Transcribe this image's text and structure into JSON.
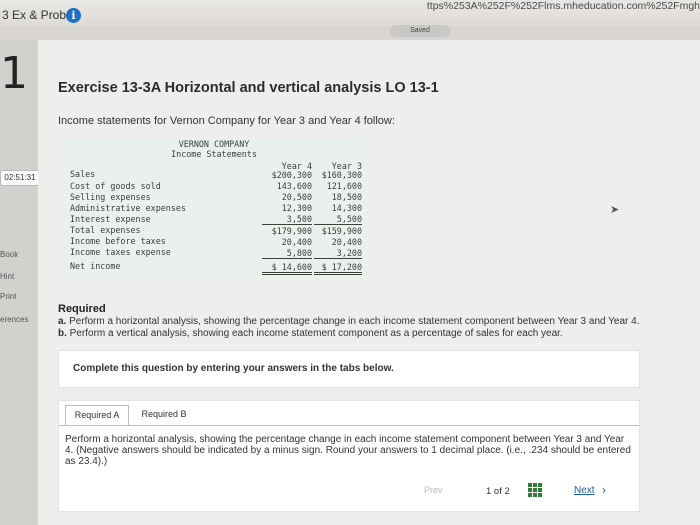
{
  "browser": {
    "tab_title": "3 Ex & Prob",
    "url": "ttps%253A%252F%252Flms.mheducation.com%252Fmgh",
    "saved_label": "Saved"
  },
  "sidebar": {
    "question_number": "1",
    "timer": "02:51:31",
    "items": [
      {
        "label": "Book"
      },
      {
        "label": "Hint"
      },
      {
        "label": "Print"
      },
      {
        "label": "erences"
      }
    ]
  },
  "exercise": {
    "title": "Exercise 13-3A Horizontal and vertical analysis LO 13-1",
    "intro": "Income statements for Vernon Company for Year 3 and Year 4 follow:"
  },
  "statement": {
    "company": "VERNON COMPANY",
    "heading": "Income Statements",
    "col_year4": "Year 4",
    "col_year3": "Year 3",
    "rows": [
      {
        "label": "Sales",
        "y4": "$200,300",
        "y3": "$160,300"
      },
      {
        "label": "Cost of goods sold",
        "y4": "143,600",
        "y3": "121,600"
      },
      {
        "label": "Selling expenses",
        "y4": "20,500",
        "y3": "18,500"
      },
      {
        "label": "Administrative expenses",
        "y4": "12,300",
        "y3": "14,300"
      },
      {
        "label": "Interest expense",
        "y4": "3,500",
        "y3": "5,500"
      },
      {
        "label": "Total expenses",
        "y4": "$179,900",
        "y3": "$159,900"
      },
      {
        "label": "Income before taxes",
        "y4": "20,400",
        "y3": "20,400"
      },
      {
        "label": "Income taxes expense",
        "y4": "5,800",
        "y3": "3,200"
      },
      {
        "label": "Net income",
        "y4": "$ 14,600",
        "y3": "$ 17,200"
      }
    ]
  },
  "required": {
    "heading": "Required",
    "a_marker": "a.",
    "a_text": "Perform a horizontal analysis, showing the percentage change in each income statement component between Year 3 and Year 4.",
    "b_marker": "b.",
    "b_text": "Perform a vertical analysis, showing each income statement component as a percentage of sales for each year."
  },
  "instructions": "Complete this question by entering your answers in the tabs below.",
  "tabs": [
    {
      "label": "Required A"
    },
    {
      "label": "Required B"
    }
  ],
  "task": "Perform a horizontal analysis, showing the percentage change in each income statement component between Year 3 and Year 4. (Negative answers should be indicated by a minus sign. Round your answers to 1 decimal place. (i.e., .234 should be entered as 23.4).)",
  "pager": {
    "prev_label": "Prev",
    "page_text": "1 of 2",
    "next_label": "Next",
    "next_icon": "chevron-right-icon"
  }
}
